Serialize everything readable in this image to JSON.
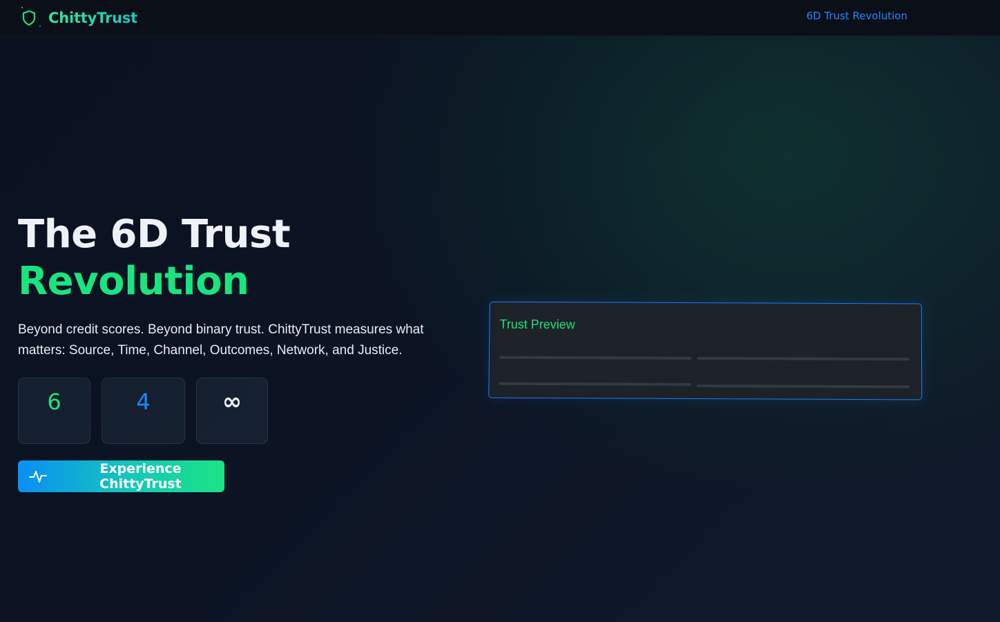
{
  "nav": {
    "brand": "ChittyTrust",
    "brand_icon": "shield-icon",
    "link": "6D Trust Revolution"
  },
  "hero": {
    "title_line1": "The 6D Trust",
    "title_line2": "Revolution",
    "description": "Beyond credit scores. Beyond binary trust. ChittyTrust measures what matters: Source, Time, Channel, Outcomes, Network, and Justice.",
    "stats": [
      {
        "value": "6",
        "color": "#22e07e"
      },
      {
        "value": "4",
        "color": "#1e88ff"
      },
      {
        "value": "∞",
        "color": "#eef2f7"
      }
    ],
    "cta_label": "Experience ChittyTrust",
    "cta_icon": "activity-icon"
  },
  "preview": {
    "title": "Trust Preview"
  },
  "colors": {
    "accent_green": "#19e57f",
    "accent_blue": "#1e88ff",
    "background": "#0c1424"
  }
}
